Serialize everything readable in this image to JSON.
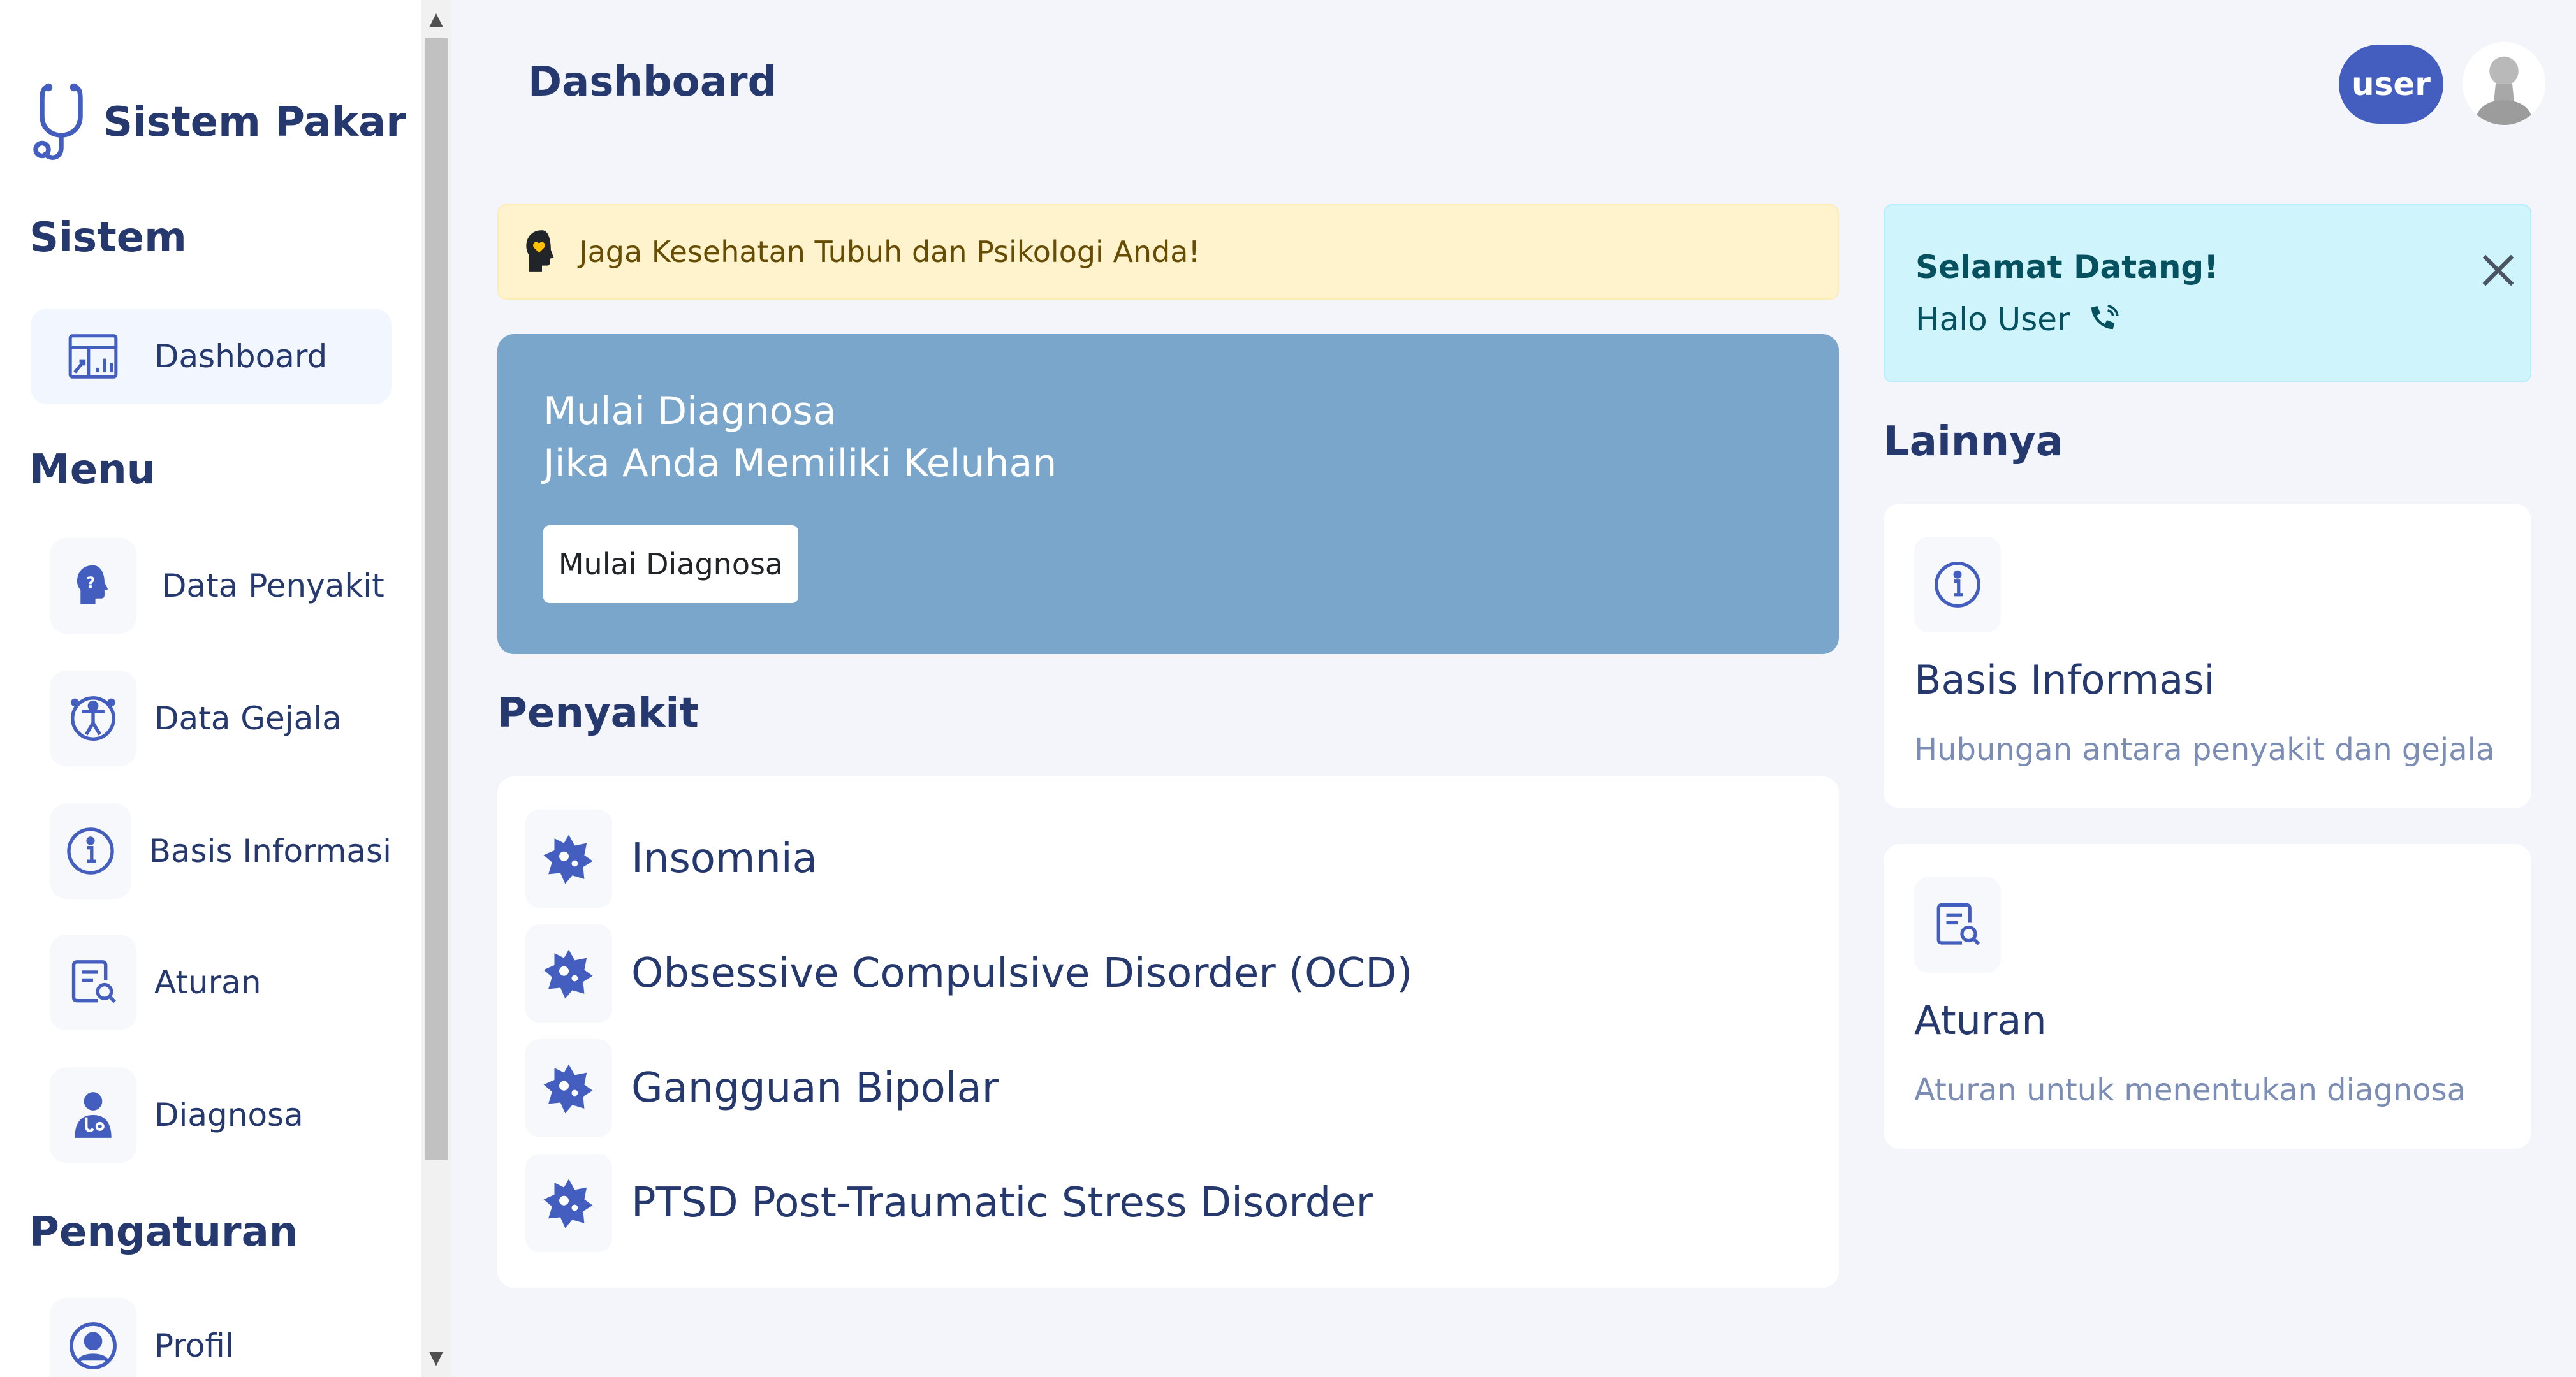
{
  "brand": {
    "name": "Sistem Pakar"
  },
  "sidebar": {
    "section_sistem": "Sistem",
    "section_menu": "Menu",
    "section_pengaturan": "Pengaturan",
    "items": [
      {
        "label": "Dashboard",
        "icon": "dashboard-chart-icon",
        "active": true
      },
      {
        "label": "Data Penyakit",
        "icon": "head-question-icon"
      },
      {
        "label": "Data Gejala",
        "icon": "virus-person-icon"
      },
      {
        "label": "Basis Informasi",
        "icon": "info-icon"
      },
      {
        "label": "Aturan",
        "icon": "document-search-icon"
      },
      {
        "label": "Diagnosa",
        "icon": "doctor-icon"
      },
      {
        "label": "Profil",
        "icon": "user-circle-icon"
      }
    ]
  },
  "header": {
    "title": "Dashboard",
    "user_badge": "user"
  },
  "alert_warning": {
    "text": "Jaga Kesehatan Tubuh dan Psikologi Anda!"
  },
  "hero": {
    "line1": "Mulai Diagnosa",
    "line2": "Jika Anda Memiliki Keluhan",
    "button": "Mulai Diagnosa"
  },
  "penyakit": {
    "title": "Penyakit",
    "items": [
      {
        "name": "Insomnia"
      },
      {
        "name": "Obsessive Compulsive Disorder (OCD)"
      },
      {
        "name": "Gangguan Bipolar"
      },
      {
        "name": "PTSD Post-Traumatic Stress Disorder"
      }
    ]
  },
  "welcome": {
    "title": "Selamat Datang!",
    "subtitle": "Halo User"
  },
  "lainnya": {
    "title": "Lainnya",
    "cards": [
      {
        "title": "Basis Informasi",
        "desc": "Hubungan antara penyakit dan gejala",
        "icon": "info-icon"
      },
      {
        "title": "Aturan",
        "desc": "Aturan untuk menentukan diagnosa",
        "icon": "document-search-icon"
      }
    ]
  },
  "colors": {
    "primary": "#435ebe",
    "hero_bg": "#79a6ca",
    "warning_bg": "#fff3cd",
    "info_bg": "#cff4fc",
    "text_dark": "#25396f"
  }
}
